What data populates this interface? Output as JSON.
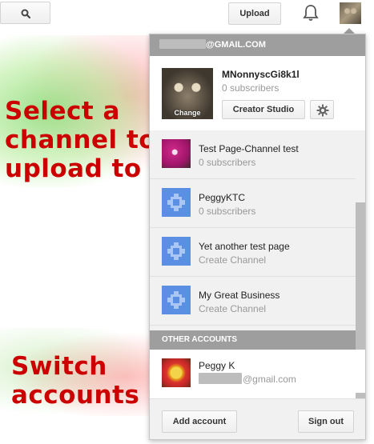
{
  "topbar": {
    "search_icon": "search-icon",
    "upload_label": "Upload",
    "notifications_icon": "bell-icon"
  },
  "annotations": {
    "select_channel": "Select a channel to upload to",
    "switch_accounts": "Switch accounts"
  },
  "account_menu": {
    "email_suffix": "@GMAIL.COM",
    "current_channel": {
      "name": "MNonnyscGi8k1l",
      "subscribers": "0 subscribers",
      "change_label": "Change",
      "creator_studio_label": "Creator Studio",
      "settings_icon": "gear-icon"
    },
    "channels": [
      {
        "title": "Test Page-Channel test",
        "subtitle": "0 subscribers",
        "thumb": "flower"
      },
      {
        "title": "PeggyKTC",
        "subtitle": "0 subscribers",
        "thumb": "generic"
      },
      {
        "title": "Yet another test page",
        "subtitle": "Create Channel",
        "thumb": "generic"
      },
      {
        "title": "My Great Business",
        "subtitle": "Create Channel",
        "thumb": "generic"
      }
    ],
    "other_accounts_header": "OTHER ACCOUNTS",
    "other_account": {
      "name": "Peggy K",
      "email_suffix": "@gmail.com"
    },
    "add_account_label": "Add account",
    "sign_out_label": "Sign out"
  },
  "colors": {
    "annotation_red": "#cc0000",
    "header_gray": "#9e9e9e",
    "channel_icon_blue": "#5b8fe4"
  }
}
